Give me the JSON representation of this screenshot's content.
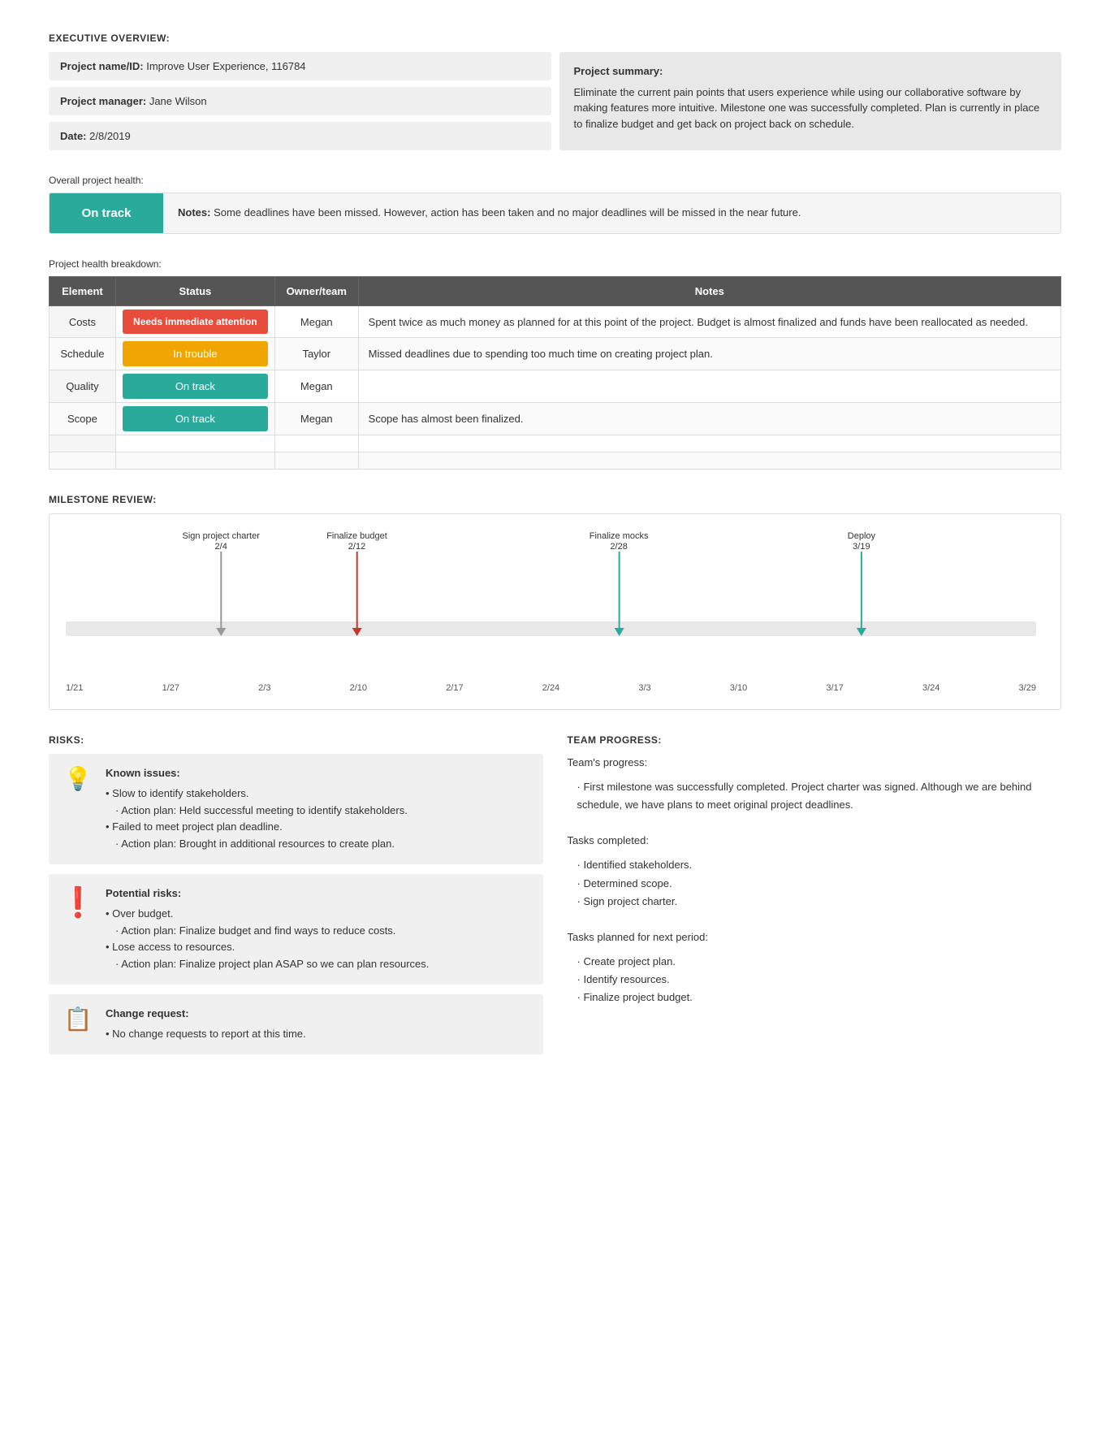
{
  "executive": {
    "section_title": "EXECUTIVE OVERVIEW:",
    "project_name_label": "Project name/ID:",
    "project_name_value": "Improve User Experience, 116784",
    "manager_label": "Project manager:",
    "manager_value": "Jane Wilson",
    "date_label": "Date:",
    "date_value": "2/8/2019",
    "summary_label": "Project summary:",
    "summary_text": "Eliminate the current pain points that users experience while using our collaborative software by making features more intuitive. Milestone one was successfully completed. Plan is currently in place to finalize budget and get back on project back on schedule."
  },
  "overall_health": {
    "label": "Overall project health:",
    "status": "On track",
    "notes_label": "Notes:",
    "notes_text": "Some deadlines have been missed. However, action has been taken and no major deadlines will be missed in the near future."
  },
  "breakdown": {
    "label": "Project health breakdown:",
    "columns": [
      "Element",
      "Status",
      "Owner/team",
      "Notes"
    ],
    "rows": [
      {
        "element": "Costs",
        "status": "Needs immediate attention",
        "status_type": "red",
        "owner": "Megan",
        "notes": "Spent twice as much money as planned for at this point of the project. Budget is almost finalized and funds have been reallocated as needed."
      },
      {
        "element": "Schedule",
        "status": "In trouble",
        "status_type": "orange",
        "owner": "Taylor",
        "notes": "Missed deadlines due to spending too much time on creating project plan."
      },
      {
        "element": "Quality",
        "status": "On track",
        "status_type": "teal",
        "owner": "Megan",
        "notes": ""
      },
      {
        "element": "Scope",
        "status": "On track",
        "status_type": "teal",
        "owner": "Megan",
        "notes": "Scope has almost been finalized."
      },
      {
        "element": "",
        "status": "",
        "status_type": "",
        "owner": "",
        "notes": ""
      },
      {
        "element": "",
        "status": "",
        "status_type": "",
        "owner": "",
        "notes": ""
      }
    ]
  },
  "milestone": {
    "section_title": "MILESTONE REVIEW:",
    "milestones": [
      {
        "label": "Sign project charter",
        "date": "2/4",
        "color": "gray",
        "position_pct": 16
      },
      {
        "label": "Finalize budget",
        "date": "2/12",
        "color": "red",
        "position_pct": 30
      },
      {
        "label": "Finalize mocks",
        "date": "2/28",
        "color": "teal",
        "position_pct": 57
      },
      {
        "label": "Deploy",
        "date": "3/19",
        "color": "teal",
        "position_pct": 82
      }
    ],
    "x_axis_labels": [
      "1/21",
      "1/27",
      "2/3",
      "2/10",
      "2/17",
      "2/24",
      "3/3",
      "3/10",
      "3/17",
      "3/24",
      "3/29"
    ]
  },
  "risks": {
    "section_title": "RISKS:",
    "cards": [
      {
        "icon": "lightbulb",
        "title": "Known issues:",
        "lines": [
          "• Slow to identify stakeholders.",
          "  · Action plan: Held successful meeting to identify stakeholders.",
          "• Failed to meet project plan deadline.",
          "  · Action plan: Brought in additional resources to create plan."
        ]
      },
      {
        "icon": "exclaim",
        "title": "Potential risks:",
        "lines": [
          "• Over budget.",
          "  · Action plan: Finalize budget and find ways to reduce costs.",
          "• Lose access to resources.",
          "  · Action plan: Finalize project plan ASAP so we can plan resources."
        ]
      },
      {
        "icon": "clipboard",
        "title": "Change request:",
        "lines": [
          "• No change requests to report at this time."
        ]
      }
    ]
  },
  "team": {
    "section_title": "TEAM PROGRESS:",
    "progress_label": "Team's progress:",
    "progress_bullets": [
      "First milestone was successfully completed. Project charter was signed. Although we are behind schedule, we have plans to meet original project deadlines."
    ],
    "completed_label": "Tasks completed:",
    "completed_bullets": [
      "Identified stakeholders.",
      "Determined scope.",
      "Sign project charter."
    ],
    "planned_label": "Tasks planned for next period:",
    "planned_bullets": [
      "Create project plan.",
      "Identify resources.",
      "Finalize project budget."
    ]
  }
}
